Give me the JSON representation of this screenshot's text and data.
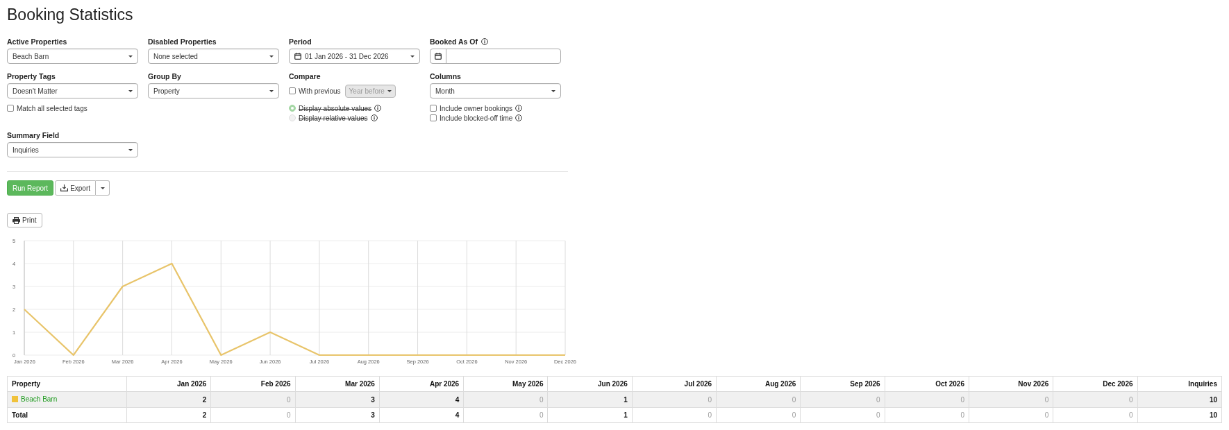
{
  "page": {
    "title": "Booking Statistics"
  },
  "filters": [
    {
      "label": "Active Properties",
      "control": {
        "kind": "select",
        "value": "Beach Barn"
      }
    },
    {
      "label": "Disabled Properties",
      "control": {
        "kind": "select",
        "value": "None selected"
      }
    },
    {
      "label": "Period",
      "control": {
        "kind": "date_range",
        "value": "01 Jan 2026 - 31 Dec 2026"
      }
    },
    {
      "label": "Booked As Of",
      "info": true,
      "control": {
        "kind": "date"
      }
    },
    {
      "label": "Property Tags",
      "control": {
        "kind": "select",
        "value": "Doesn't Matter"
      },
      "extras": [
        {
          "kind": "checkbox",
          "label": "Match all selected tags",
          "checked": false
        }
      ]
    },
    {
      "label": "Group By",
      "control": {
        "kind": "select",
        "value": "Property"
      }
    },
    {
      "label": "Compare",
      "control": {
        "kind": "check_select",
        "check_label": "With previous",
        "checked": false,
        "select_value": "Year before",
        "select_disabled": true
      },
      "extras": [
        {
          "kind": "radio",
          "label": "Display absolute values",
          "selected": true,
          "disabled": true,
          "info": true
        },
        {
          "kind": "radio",
          "label": "Display relative values",
          "selected": false,
          "disabled": true,
          "info": true
        }
      ]
    },
    {
      "label": "Columns",
      "control": {
        "kind": "select",
        "value": "Month"
      },
      "extras": [
        {
          "kind": "checkbox",
          "label": "Include owner bookings",
          "checked": false,
          "info": true
        },
        {
          "kind": "checkbox",
          "label": "Include blocked-off time",
          "checked": false,
          "info": true
        }
      ]
    },
    {
      "label": "Summary Field",
      "control": {
        "kind": "select",
        "value": "Inquiries"
      }
    }
  ],
  "actions": [
    {
      "kind": "primary",
      "label": "Run Report"
    },
    {
      "kind": "split",
      "label": "Export"
    }
  ],
  "print": {
    "label": "Print"
  },
  "chart": {
    "chart_data": {
      "type": "line",
      "categories": [
        "Jan 2026",
        "Feb 2026",
        "Mar 2026",
        "Apr 2026",
        "May 2026",
        "Jun 2026",
        "Jul 2026",
        "Aug 2026",
        "Sep 2026",
        "Oct 2026",
        "Nov 2026",
        "Dec 2026"
      ],
      "series": [
        {
          "color": "#e8c46a",
          "values": [
            2,
            0,
            3,
            4,
            0,
            1,
            0,
            0,
            0,
            0,
            0,
            0
          ]
        }
      ],
      "ylim": [
        0,
        5
      ],
      "yticks": [
        0,
        1,
        2,
        3,
        4,
        5
      ],
      "grid": true
    }
  },
  "table": {
    "columns": [
      "Property",
      "Jan 2026",
      "Feb 2026",
      "Mar 2026",
      "Apr 2026",
      "May 2026",
      "Jun 2026",
      "Jul 2026",
      "Aug 2026",
      "Sep 2026",
      "Oct 2026",
      "Nov 2026",
      "Dec 2026",
      "Inquiries"
    ],
    "rows": [
      {
        "kind": "item",
        "color": "#f0c23b",
        "cells": [
          "Beach Barn",
          "2",
          "0",
          "3",
          "4",
          "0",
          "1",
          "0",
          "0",
          "0",
          "0",
          "0",
          "0",
          "10"
        ]
      },
      {
        "kind": "total",
        "cells": [
          "Total",
          "2",
          "0",
          "3",
          "4",
          "0",
          "1",
          "0",
          "0",
          "0",
          "0",
          "0",
          "0",
          "10"
        ]
      }
    ]
  }
}
